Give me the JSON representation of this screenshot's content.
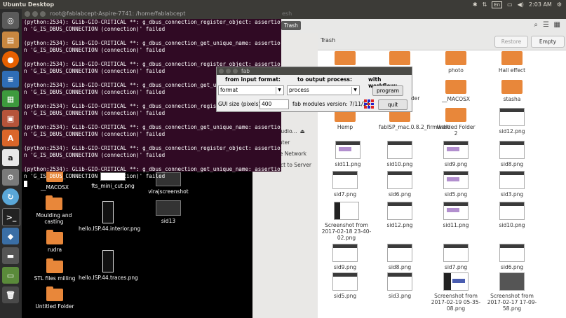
{
  "top_panel": {
    "title": "Ubuntu Desktop",
    "keyboard": "En",
    "time": "2:03 AM"
  },
  "launcher": {
    "items": [
      "dash",
      "files",
      "firefox",
      "writer",
      "calc",
      "impress",
      "software",
      "amazon",
      "settings",
      "updater",
      "terminal",
      "python",
      "drive",
      "usb",
      "trash"
    ]
  },
  "terminal": {
    "title": "root@fablabcept-Aspire-7741: /home/fablabcept",
    "lines": [
      "(python:2534): GLib-GIO-CRITICAL **: g_dbus_connection_register_object: assertio",
      "n 'G_IS_DBUS_CONNECTION (connection)' failed",
      "",
      "(python:2534): GLib-GIO-CRITICAL **: g_dbus_connection_get_unique_name: assertio",
      "n 'G_IS_DBUS_CONNECTION (connection)' failed",
      "",
      "(python:2534): GLib-GIO-CRITICAL **: g_dbus_connection_register_object: assertio",
      "n 'G_IS_DBUS_CONNECTION (connection)' failed",
      "",
      "(python:2534): GLib-GIO-CRITICAL **: g_dbus_connection_get_unique_name: assertio",
      "n 'G_IS_DBUS_CONNECTION (connection)' failed",
      "",
      "(python:2534): GLib-GIO-CRITICAL **: g_dbus_connection_register_object: assertio",
      "n 'G_IS_DBUS_CONNECTION (connection)' failed",
      "",
      "(python:2534): GLib-GIO-CRITICAL **: g_dbus_connection_get_unique_name: assertio",
      "n 'G_IS_DBUS_CONNECTION (connection)' failed",
      "",
      "(python:2534): GLib-GIO-CRITICAL **: g_dbus_connection_register_object: assertio",
      "n 'G_IS_DBUS_CONNECTION (connection)' failed",
      "",
      "(python:2534): GLib-GIO-CRITICAL **: g_dbus_connection_get_unique_name: assertio",
      "n 'G_IS_DBUS_CONNECTION (connection)' failed"
    ]
  },
  "desktop": {
    "items": [
      "__MACOSX",
      "fts_mini_cut.png",
      "virajscreenshot",
      "Moulding and casting",
      "hello.ISP.44.interior.png",
      "sid13",
      "rudra",
      "hello.ISP.44.traces.png",
      "STL files milling",
      "Untitled Folder"
    ]
  },
  "fm": {
    "title_suffix": "esh",
    "crumb": "Trash",
    "trash_label": "Trash",
    "restore": "Restore",
    "empty": "Empty",
    "sidebar": [
      "ws",
      "nux-Studio...",
      "Computer",
      "Browse Network",
      "Connect to Server"
    ],
    "partial": [
      "ta",
      "der"
    ],
    "items": [
      "photo",
      "Hall effect",
      "__MACOSX",
      "stasha",
      "Hemp",
      "fabISP_mac.0.8.2_firmware",
      "Untitled Folder 2",
      "sid12.png",
      "sid11.png",
      "sid10.png",
      "sid9.png",
      "sid8.png",
      "sid7.png",
      "sid6.png",
      "sid5.png",
      "sid3.png",
      "Screenshot from 2017-02-18 23-40-02.png",
      "sid12.png",
      "sid11.png",
      "sid10.png",
      "sid9.png",
      "sid8.png",
      "sid7.png",
      "sid6.png",
      "sid5.png",
      "sid3.png",
      "Screenshot from 2017-02-19 05-35-08.png",
      "Screenshot from 2017-02-17 17-09-58.png"
    ]
  },
  "fab": {
    "title": "fab",
    "from_label": "from input format:",
    "to_label": "to output process:",
    "workflow_label": "with workflow:",
    "format_value": "format",
    "process_value": "process",
    "program_btn": "program",
    "gui_label": "GUI size (pixels):",
    "gui_value": "400",
    "version": "fab modules version: 7/11/14",
    "quit_btn": "quit"
  }
}
